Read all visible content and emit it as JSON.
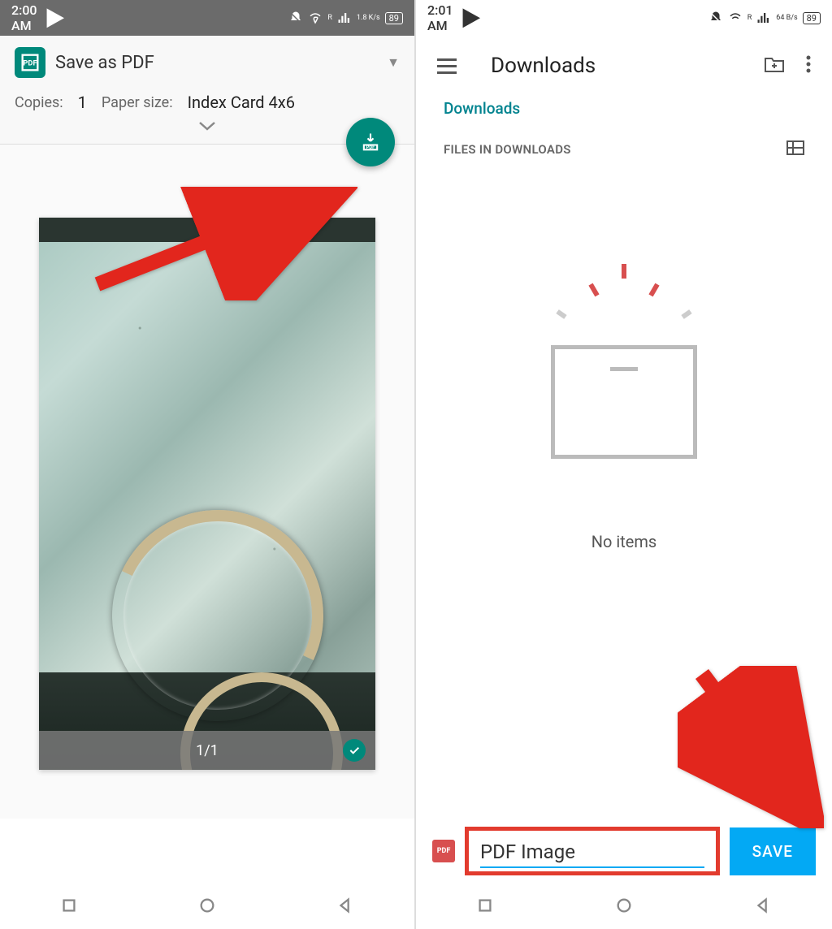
{
  "left": {
    "status": {
      "time": "2:00 AM",
      "data_rate": "1.8 K/s",
      "battery": "89",
      "signal_label": "R"
    },
    "print": {
      "destination": "Save as PDF",
      "copies_label": "Copies:",
      "copies_value": "1",
      "paper_label": "Paper size:",
      "paper_value": "Index Card 4x6",
      "page_indicator": "1/1"
    }
  },
  "right": {
    "status": {
      "time": "2:01 AM",
      "data_rate": "64 B/s",
      "battery": "89",
      "signal_label": "R"
    },
    "header": {
      "title": "Downloads"
    },
    "breadcrumb": "Downloads",
    "section_label": "FILES IN DOWNLOADS",
    "empty_text": "No items",
    "filename_value": "PDF Image",
    "save_label": "SAVE"
  }
}
